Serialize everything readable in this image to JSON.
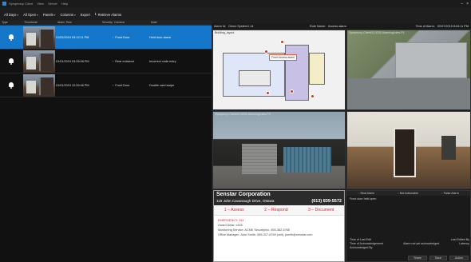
{
  "titlebar": {
    "menu": [
      "Symphony Client",
      "View",
      "Server",
      "Help"
    ],
    "win_controls": [
      "–",
      "×"
    ]
  },
  "toolbar": {
    "all_days": "All Days",
    "all_open": "All Open",
    "panels": "Panels",
    "columns": "Columns",
    "export": "Export",
    "retrieve": "Retrieve Alarms"
  },
  "table": {
    "headers": [
      "Type",
      "Thumbnail",
      "Alarm Time",
      "Severity",
      "Camera",
      "Note"
    ],
    "rows": [
      {
        "time": "01/02/2019 03:12:11 PM",
        "camera": "Front Door",
        "note": "Held door alarm"
      },
      {
        "time": "01/01/2019 03:05:08 PM",
        "camera": "Rear entrance",
        "note": "Incorrect code entry"
      },
      {
        "time": "01/01/2019 12:59:46 PM",
        "camera": "Front Door",
        "note": "Double card swipe"
      }
    ]
  },
  "alarm_header": {
    "alarm_id_label": "Alarm Id:",
    "alarm_id_value": "Demo System1.14",
    "rule_label": "Rule Name:",
    "rule_value": "Access alarm",
    "time_label": "Time of Alarm:",
    "time_value": "02/07/2019 8:04:11 PM"
  },
  "panes": {
    "map_caption": "Building_layout",
    "map_marker": "Front Access alarm",
    "cam1_caption": "Symphony-Client02-0005-Alarmlog/view-P1",
    "cam2_caption": "Symphony-Client02-0005-Alarmlog/view-P3",
    "cam3_caption": "Symphony-Client02-0005-Alarmlog/view-P4"
  },
  "sop": {
    "company": "Senstar Corporation",
    "address": "119 John Cavanaugh Drive, Ottawa",
    "phone": "(613) 839-5572",
    "steps": [
      "1 – Assess",
      "2 – Respond",
      "3 – Document"
    ],
    "emergency": "EMERGENCY: 911",
    "guard": "Guard Desk: x328",
    "monitoring": "Monitoring Service: ACME SecurityInc. 555-382-6765",
    "manager": "Office Manager: John Smith: 555-317-6769 (cell), jsmith@senstar.com"
  },
  "details": {
    "tabs": [
      "Real Alarm",
      "Not Actionable",
      "False Alarm"
    ],
    "description": "Front door held open",
    "last_edit_label": "Time of Last Edit",
    "last_edited_by_label": "Last Edited By",
    "ack_label": "Time of Acknowledgement",
    "ack_value": "Alarm not yet acknowledged",
    "ack_state": "Latency",
    "ack_by_label": "Acknowledged By",
    "buttons": [
      "Share",
      "Save",
      "Action"
    ]
  }
}
